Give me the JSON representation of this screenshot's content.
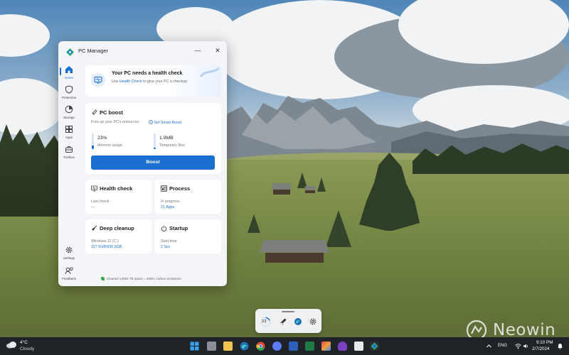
{
  "window": {
    "title": "PC Manager",
    "minimize_glyph": "—",
    "close_glyph": "✕"
  },
  "sidebar": {
    "items": [
      {
        "label": "Home",
        "icon": "home-icon",
        "active": true
      },
      {
        "label": "Protection",
        "icon": "shield-icon"
      },
      {
        "label": "Storage",
        "icon": "storage-icon"
      },
      {
        "label": "Apps",
        "icon": "apps-icon"
      },
      {
        "label": "Toolbox",
        "icon": "toolbox-icon"
      },
      {
        "label": "Settings",
        "icon": "gear-icon"
      },
      {
        "label": "Feedback",
        "icon": "feedback-icon"
      }
    ]
  },
  "health_banner": {
    "title": "Your PC needs a health check",
    "subtitle_pre": "Use ",
    "subtitle_link": "Health Check",
    "subtitle_post": " to give your PC a checkup"
  },
  "pc_boost": {
    "title": "PC boost",
    "subtitle": "Free up your PC's resources",
    "smart_boost_link": "Set Smart Boost",
    "memory_value": "23%",
    "memory_fraction": 0.23,
    "memory_label": "Memory usage",
    "temp_value": "1.9MB",
    "temp_fraction": 0.1,
    "temp_label": "Temporary files",
    "button_label": "Boost"
  },
  "tiles": {
    "health_check": {
      "title": "Health check",
      "line1": "Last check",
      "line2": "—"
    },
    "process": {
      "title": "Process",
      "line1": "In progress",
      "line2": "21 Apps"
    },
    "deep_cleanup": {
      "title": "Deep cleanup",
      "line1": "Windows 11 (C:)",
      "line2": "327.5GB/930.6GB"
    },
    "startup": {
      "title": "Startup",
      "line1": "Start time",
      "line2": "2 Sec"
    }
  },
  "footer_note": "Cleaned 14084 TB space = 3600 t carbon emissions",
  "widget": {
    "memory_value": "23"
  },
  "watermark": "Neowin",
  "taskbar": {
    "temp": "4°C",
    "condition": "Cloudy",
    "language": "ENG",
    "time": "9:10 PM",
    "date": "2/7/2024"
  },
  "colors": {
    "accent": "#1a6fd0",
    "taskbar": "#1f2226",
    "window_bg": "#f3f5f8"
  }
}
